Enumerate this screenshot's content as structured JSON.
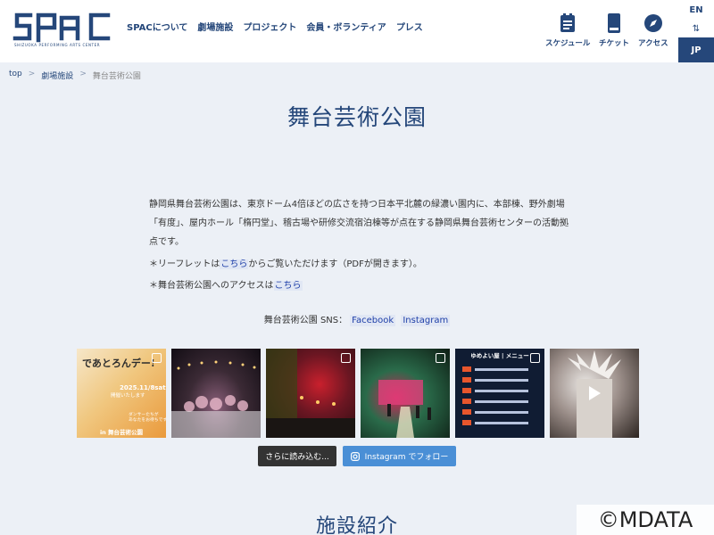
{
  "header": {
    "logo_text": "SPAC",
    "logo_subtitle": "SHIZUOKA PERFORMING ARTS CENTER",
    "nav": [
      "SPACについて",
      "劇場施設",
      "プロジェクト",
      "会員・ボランティア",
      "プレス"
    ],
    "utility": [
      {
        "label": "スケジュール",
        "icon": "calendar-icon"
      },
      {
        "label": "チケット",
        "icon": "ticket-icon"
      },
      {
        "label": "アクセス",
        "icon": "compass-icon"
      }
    ],
    "lang": {
      "en": "EN",
      "switch": "⇅",
      "jp": "JP"
    },
    "accent_color": "#25477a"
  },
  "breadcrumb": {
    "items": [
      "top",
      "劇場施設",
      "舞台芸術公園"
    ],
    "separator": ">"
  },
  "page_title": "舞台芸術公園",
  "intro": "静岡県舞台芸術公園は、東京ドーム4倍ほどの広さを持つ日本平北麓の緑濃い園内に、本部棟、野外劇場「有度」、屋内ホール「楕円堂」、稽古場や研修交流宿泊棟等が点在する静岡県舞台芸術センターの活動拠点です。",
  "notes": {
    "leaflet": {
      "before": "＊リーフレットは",
      "link": "こちら",
      "after": "からご覧いただけます（PDFが開きます）。"
    },
    "access": {
      "before": "＊舞台芸術公園へのアクセスは",
      "link": "こちら"
    }
  },
  "sns": {
    "label": "舞台芸術公園 SNS：",
    "facebook": "Facebook",
    "instagram": "Instagram"
  },
  "instagram_feed": {
    "posts": [
      {
        "headline": "であとろんデー!",
        "date": "2025.11/8sat.",
        "caption": "開催いたします",
        "sub": "ダンサーたちが\nあなたをお待ちです",
        "footer": "in 舞台芸術公園",
        "icon": "carousel-icon"
      },
      {
        "icon": "none"
      },
      {
        "icon": "carousel-icon"
      },
      {
        "icon": "carousel-icon"
      },
      {
        "menu_title": "ゆめよい屋 | メニュー",
        "icon": "carousel-icon"
      },
      {
        "icon": "play-icon"
      }
    ],
    "load_more": "さらに読み込む...",
    "follow": "Instagram でフォロー"
  },
  "section_heading": "施設紹介",
  "watermark": "©MDATA"
}
